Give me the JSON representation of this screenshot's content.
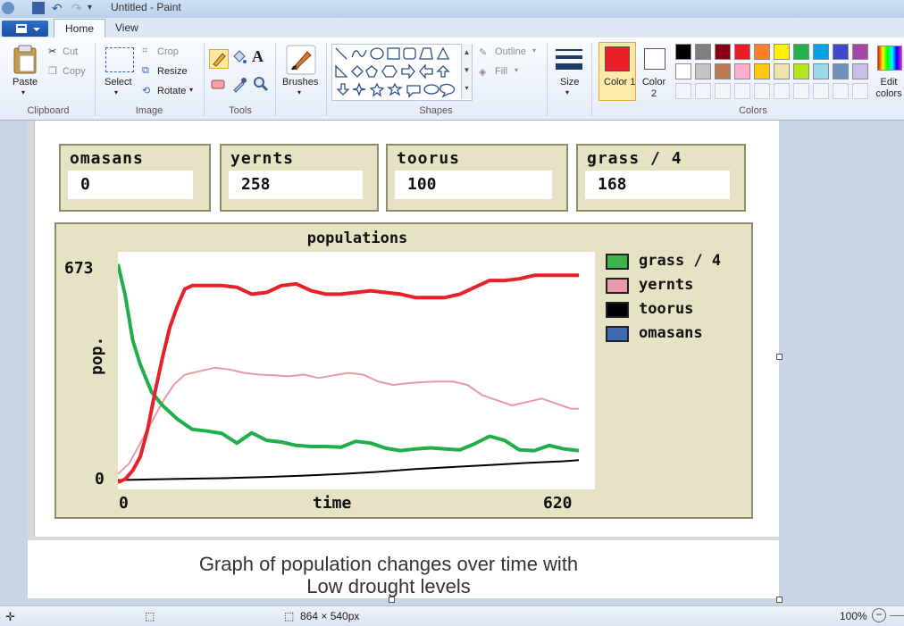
{
  "app": {
    "title": "Untitled - Paint",
    "tabs": [
      "Home",
      "View"
    ]
  },
  "ribbon": {
    "clipboard": {
      "paste": "Paste",
      "cut": "Cut",
      "copy": "Copy",
      "label": "Clipboard"
    },
    "image": {
      "select": "Select",
      "crop": "Crop",
      "resize": "Resize",
      "rotate": "Rotate",
      "label": "Image"
    },
    "tools": {
      "label": "Tools"
    },
    "brushes": {
      "label": "Brushes"
    },
    "shapes": {
      "outline": "Outline",
      "fill": "Fill",
      "label": "Shapes"
    },
    "size": {
      "label": "Size"
    },
    "colors": {
      "color1": "Color 1",
      "color2": "Color 2",
      "edit": "Edit colors",
      "label": "Colors",
      "color1_value": "#e8202a",
      "color2_value": "#ffffff",
      "palette_row1": [
        "#000000",
        "#7f7f7f",
        "#880015",
        "#ed1c24",
        "#ff7f27",
        "#fff200",
        "#22b14c",
        "#00a2e8",
        "#3f48cc",
        "#a349a4"
      ],
      "palette_row2": [
        "#ffffff",
        "#c3c3c3",
        "#b97a57",
        "#ffaec9",
        "#ffc90e",
        "#efe4b0",
        "#b5e61d",
        "#99d9ea",
        "#7092be",
        "#c8bfe7"
      ]
    }
  },
  "monitors": [
    {
      "label": "omasans",
      "value": "0"
    },
    {
      "label": "yernts",
      "value": "258"
    },
    {
      "label": "toorus",
      "value": "100"
    },
    {
      "label": "grass / 4",
      "value": "168"
    }
  ],
  "plot": {
    "title": "populations",
    "ylabel": "pop.",
    "xlabel": "time",
    "ymax_label": "673",
    "ymin_label": "0",
    "xmin_label": "0",
    "xmax_label": "620",
    "legend": [
      {
        "name": "grass / 4",
        "color": "#3cb44b"
      },
      {
        "name": "yernts",
        "color": "#e89aa8"
      },
      {
        "name": "toorus",
        "color": "#000000"
      },
      {
        "name": "omasans",
        "color": "#3d6ab5"
      }
    ]
  },
  "chart_data": {
    "type": "line",
    "title": "populations",
    "xlabel": "time",
    "ylabel": "pop.",
    "xlim": [
      0,
      620
    ],
    "ylim": [
      0,
      673
    ],
    "series": [
      {
        "name": "grass / 4",
        "color": "#1fae4a",
        "x": [
          0,
          10,
          20,
          30,
          45,
          60,
          80,
          100,
          120,
          140,
          160,
          180,
          200,
          220,
          240,
          260,
          280,
          300,
          320,
          340,
          360,
          380,
          400,
          420,
          440,
          460,
          480,
          500,
          520,
          540,
          560,
          580,
          600,
          620
        ],
        "y": [
          653,
          560,
          430,
          360,
          280,
          240,
          200,
          170,
          165,
          158,
          130,
          160,
          138,
          133,
          123,
          120,
          120,
          118,
          135,
          130,
          115,
          108,
          113,
          116,
          113,
          110,
          128,
          150,
          138,
          110,
          108,
          123,
          113,
          108
        ]
      },
      {
        "name": "yernts",
        "color": "#e89aa8",
        "x": [
          0,
          15,
          30,
          45,
          60,
          75,
          90,
          110,
          130,
          150,
          170,
          190,
          210,
          230,
          250,
          270,
          290,
          310,
          330,
          350,
          370,
          390,
          410,
          430,
          450,
          470,
          490,
          510,
          530,
          550,
          570,
          590,
          610,
          620
        ],
        "y": [
          40,
          70,
          130,
          190,
          250,
          300,
          330,
          340,
          350,
          345,
          335,
          330,
          328,
          325,
          330,
          320,
          328,
          335,
          330,
          310,
          300,
          305,
          308,
          310,
          310,
          300,
          270,
          255,
          240,
          250,
          260,
          245,
          230,
          230
        ]
      },
      {
        "name": "toorus",
        "color": "#000000",
        "x": [
          0,
          50,
          100,
          150,
          200,
          250,
          300,
          350,
          400,
          450,
          500,
          550,
          600,
          620
        ],
        "y": [
          22,
          24,
          26,
          28,
          31,
          35,
          40,
          46,
          54,
          60,
          66,
          72,
          77,
          80
        ]
      },
      {
        "name": "omasans",
        "color": "#e8202a",
        "x": [
          0,
          10,
          20,
          30,
          40,
          50,
          60,
          70,
          80,
          90,
          100,
          120,
          140,
          160,
          180,
          200,
          220,
          240,
          260,
          280,
          300,
          320,
          340,
          360,
          380,
          400,
          420,
          440,
          460,
          480,
          500,
          520,
          540,
          560,
          580,
          600,
          620
        ],
        "y": [
          15,
          25,
          50,
          90,
          170,
          280,
          380,
          470,
          530,
          580,
          590,
          590,
          590,
          585,
          565,
          570,
          590,
          595,
          575,
          565,
          565,
          570,
          575,
          570,
          565,
          555,
          555,
          555,
          565,
          585,
          605,
          605,
          610,
          620,
          620,
          620,
          620
        ]
      }
    ]
  },
  "caption": {
    "line1": "Graph of population changes over time with",
    "line2": "Low drought levels"
  },
  "status": {
    "dimensions": "864 × 540px",
    "zoom": "100%"
  }
}
